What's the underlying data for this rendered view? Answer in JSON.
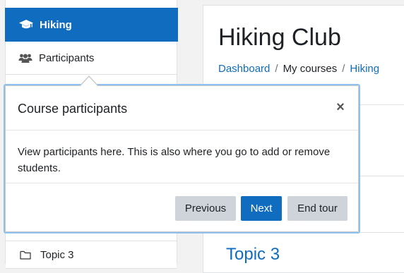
{
  "sidebar": {
    "active_item": {
      "label": "Hiking",
      "icon": "graduation-cap-icon"
    },
    "participants_item": {
      "label": "Participants",
      "icon": "users-icon"
    },
    "topic3_item": {
      "label": "Topic 3",
      "icon": "folder-icon"
    }
  },
  "main": {
    "course_title": "Hiking Club",
    "breadcrumb": [
      "Dashboard",
      "My courses",
      "Hiking"
    ],
    "breadcrumb_separator": "/",
    "topic_heading": "Topic 3"
  },
  "tour": {
    "title": "Course participants",
    "close_symbol": "×",
    "body": "View participants here. This is also where you go to add or remove students.",
    "buttons": {
      "previous": "Previous",
      "next": "Next",
      "end": "End tour"
    }
  },
  "colors": {
    "accent": "#0f6cbf",
    "highlight_border": "#8fc1f0",
    "secondary_button": "#ced4da"
  }
}
